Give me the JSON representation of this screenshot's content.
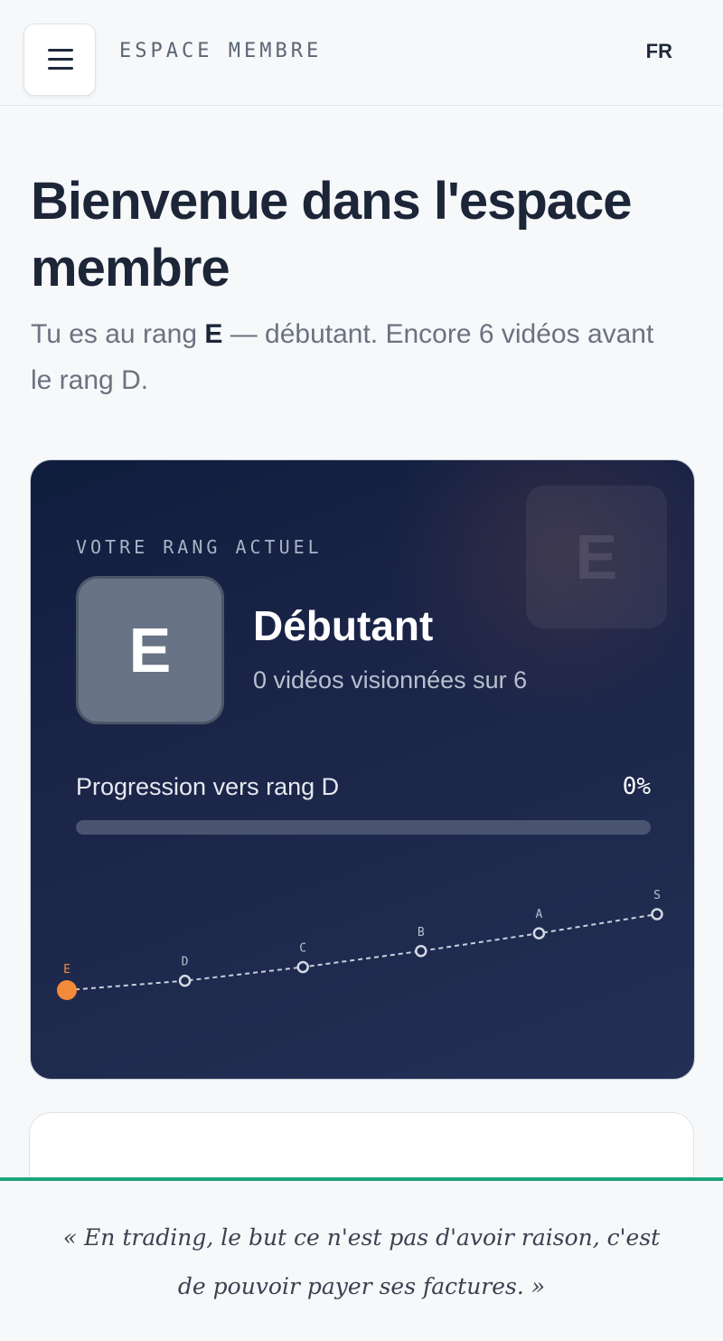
{
  "header": {
    "brand": "ESPACE MEMBRE",
    "language": "FR",
    "menu_icon": "hamburger-menu-icon"
  },
  "hero": {
    "title": "Bienvenue dans l'espace membre",
    "subtitle_pre": "Tu es au rang ",
    "subtitle_rank": "E",
    "subtitle_post": " — débutant. Encore 6 vidéos avant le rang D."
  },
  "rank_card": {
    "label": "VOTRE RANG ACTUEL",
    "rank_letter": "E",
    "rank_name": "Débutant",
    "videos_text": "0 vidéos visionnées sur 6",
    "progress_label": "Progression vers rang D",
    "progress_pct_text": "0%",
    "progress_value": 0,
    "accent_color": "#f38a3a",
    "ranks": [
      {
        "letter": "E",
        "level": 0,
        "current": true
      },
      {
        "letter": "D",
        "level": 1
      },
      {
        "letter": "C",
        "level": 2
      },
      {
        "letter": "B",
        "level": 3
      },
      {
        "letter": "A",
        "level": 4
      },
      {
        "letter": "S",
        "level": 5
      }
    ]
  },
  "quote": "« En trading, le but ce n'est pas d'avoir raison, c'est de pouvoir payer ses factures. »"
}
